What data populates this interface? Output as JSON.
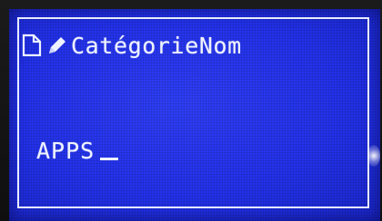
{
  "screen": {
    "header": {
      "icons": [
        "document-icon",
        "pencil-icon"
      ],
      "title": "CatégorieNom"
    },
    "input": {
      "value": "APPS"
    }
  },
  "colors": {
    "lcd_background": "#2332ea",
    "lcd_text": "#eef2ff",
    "bezel": "#141414"
  }
}
